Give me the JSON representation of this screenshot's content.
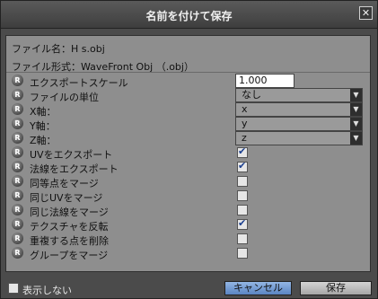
{
  "window": {
    "title": "名前を付けて保存",
    "close_label": "✕"
  },
  "info": {
    "filename_line": "ファイル名：H s.obj",
    "format_line": "ファイル形式：WaveFront Obj （.obj）"
  },
  "badge_label": "R",
  "rows": {
    "export_scale": {
      "label": "エクスポートスケール",
      "value": "1.000"
    },
    "file_unit": {
      "label": "ファイルの単位",
      "value": "なし"
    },
    "x_axis": {
      "label": "X軸：",
      "value": "x"
    },
    "y_axis": {
      "label": "Y軸：",
      "value": "y"
    },
    "z_axis": {
      "label": "Z軸：",
      "value": "z"
    },
    "export_uv": {
      "label": "UVをエクスポート",
      "checked": true
    },
    "export_normals": {
      "label": "法線をエクスポート",
      "checked": true
    },
    "merge_equal_points": {
      "label": "同等点をマージ",
      "checked": false
    },
    "merge_same_uv": {
      "label": "同じUVをマージ",
      "checked": false
    },
    "merge_same_normals": {
      "label": "同じ法線をマージ",
      "checked": false
    },
    "flip_texture": {
      "label": "テクスチャを反転",
      "checked": true
    },
    "remove_duplicate_points": {
      "label": "重複する点を削除",
      "checked": false
    },
    "merge_groups": {
      "label": "グループをマージ",
      "checked": false
    }
  },
  "dropdown_arrow": "▼",
  "check_mark": "✔",
  "footer": {
    "dont_show_label": "表示しない",
    "cancel_label": "キャンセル",
    "save_label": "保存"
  }
}
